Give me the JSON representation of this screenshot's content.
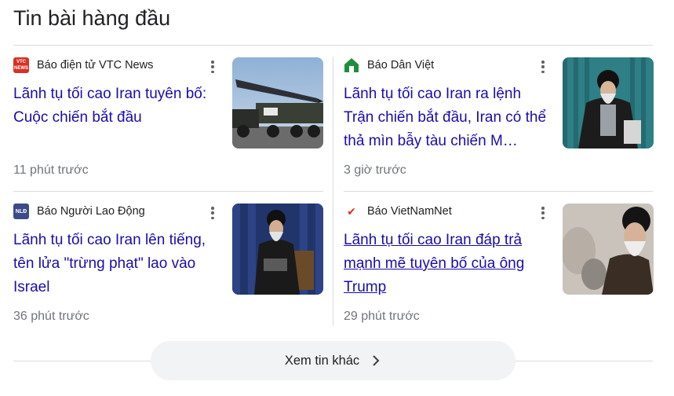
{
  "section": {
    "title": "Tin bài hàng đầu"
  },
  "articles": [
    {
      "source": "Báo điện tử VTC News",
      "logo_text": "VTC NEWS",
      "logo_color": "#d93025",
      "headline": "Lãnh tụ tối cao Iran tuyên bố: Cuộc chiến bắt đầu",
      "time": "11 phút trước",
      "image_subject": "missile-on-truck"
    },
    {
      "source": "Báo Dân Việt",
      "logo_text": "",
      "logo_color": "#1e8e3e",
      "headline": "Lãnh tụ tối cao Iran ra lệnh Trận chiến bắt đầu, Iran có thể thả mìn bẫy tàu chiến M…",
      "time": "3 giờ trước",
      "image_subject": "cleric-speaking"
    },
    {
      "source": "Báo Người Lao Động",
      "logo_text": "NLĐ",
      "logo_color": "#3c4a8a",
      "headline": "Lãnh tụ tối cao Iran lên tiếng, tên lửa \"trừng phạt\" lao vào Israel",
      "time": "36 phút trước",
      "image_subject": "cleric-seated"
    },
    {
      "source": "Báo VietNamNet",
      "logo_text": "✔",
      "logo_color": "#d93025",
      "headline": "Lãnh tụ tối cao Iran đáp trả mạnh mẽ tuyên bố của ông Trump",
      "time": "29 phút trước",
      "image_subject": "cleric-portrait"
    }
  ],
  "more_button": {
    "label": "Xem tin khác",
    "icon": "chevron-right-icon"
  }
}
